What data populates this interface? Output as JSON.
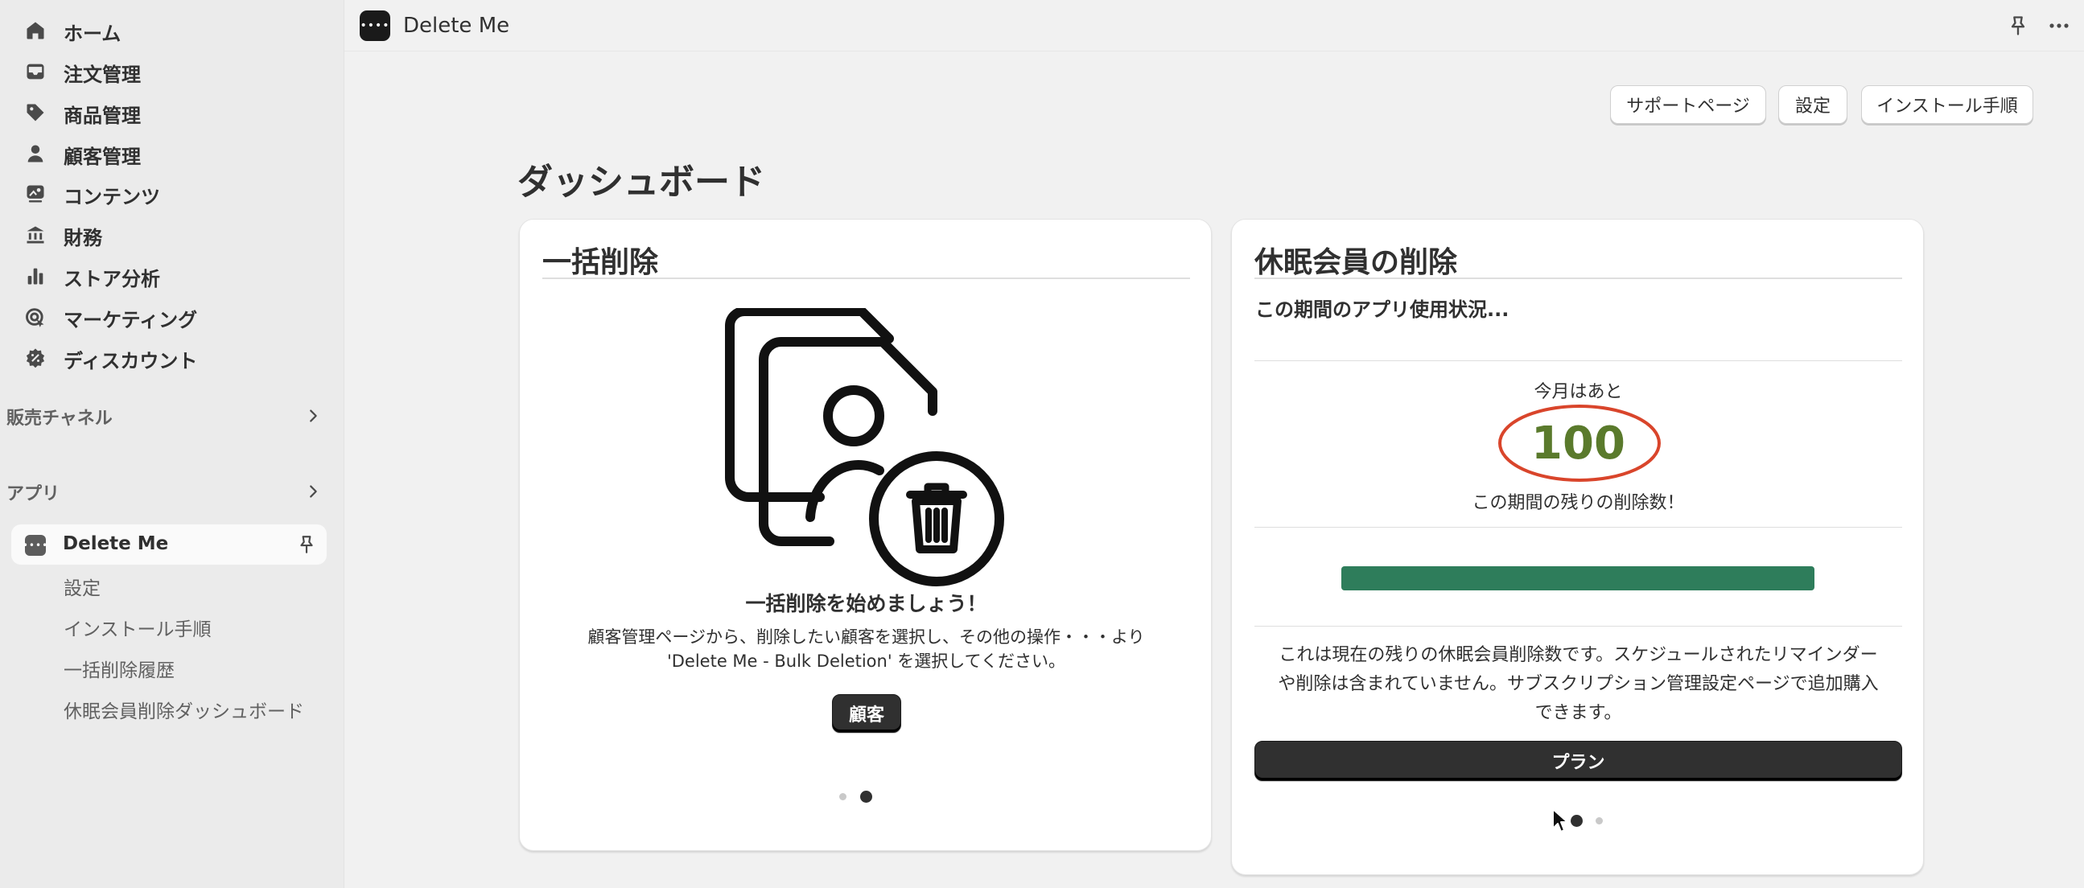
{
  "sidebar": {
    "nav": [
      {
        "label": "ホーム",
        "icon": "home-icon"
      },
      {
        "label": "注文管理",
        "icon": "inbox-icon"
      },
      {
        "label": "商品管理",
        "icon": "tag-icon"
      },
      {
        "label": "顧客管理",
        "icon": "person-icon"
      },
      {
        "label": "コンテンツ",
        "icon": "image-icon"
      },
      {
        "label": "財務",
        "icon": "bank-icon"
      },
      {
        "label": "ストア分析",
        "icon": "bar-chart-icon"
      },
      {
        "label": "マーケティング",
        "icon": "target-icon"
      },
      {
        "label": "ディスカウント",
        "icon": "discount-icon"
      }
    ],
    "sales_channels": "販売チャネル",
    "apps": "アプリ",
    "app_item": "Delete Me",
    "sub_items": [
      "設定",
      "インストール手順",
      "一括削除履歴",
      "休眠会員削除ダッシュボード"
    ]
  },
  "topbar": {
    "app_title": "Delete Me"
  },
  "header_buttons": {
    "support": "サポートページ",
    "settings": "設定",
    "install": "インストール手順"
  },
  "page_title": "ダッシュボード",
  "bulk_card": {
    "title": "一括削除",
    "heading": "一括削除を始めましょう！",
    "desc_line1": "顧客管理ページから、削除したい顧客を選択し、その他の操作・・・より",
    "desc_line2": "'Delete Me - Bulk Deletion' を選択してください。",
    "button": "顧客"
  },
  "dormant_card": {
    "title": "休眠会員の削除",
    "subtitle": "この期間のアプリ使用状況...",
    "remaining_label": "今月はあと",
    "remaining_count": "100",
    "remaining_caption": "この期間の残りの削除数！",
    "progress_fraction": 1.0,
    "note_line1": "これは現在の残りの休眠会員削除数です。スケジュールされたリマインダー",
    "note_line2": "や削除は含まれていません。サブスクリプション管理設定ページで追加購入",
    "note_line3": "できます。",
    "button": "プラン"
  },
  "colors": {
    "progress": "#2e7d5b",
    "count": "#5a7a2c",
    "circle": "#d9452b"
  }
}
